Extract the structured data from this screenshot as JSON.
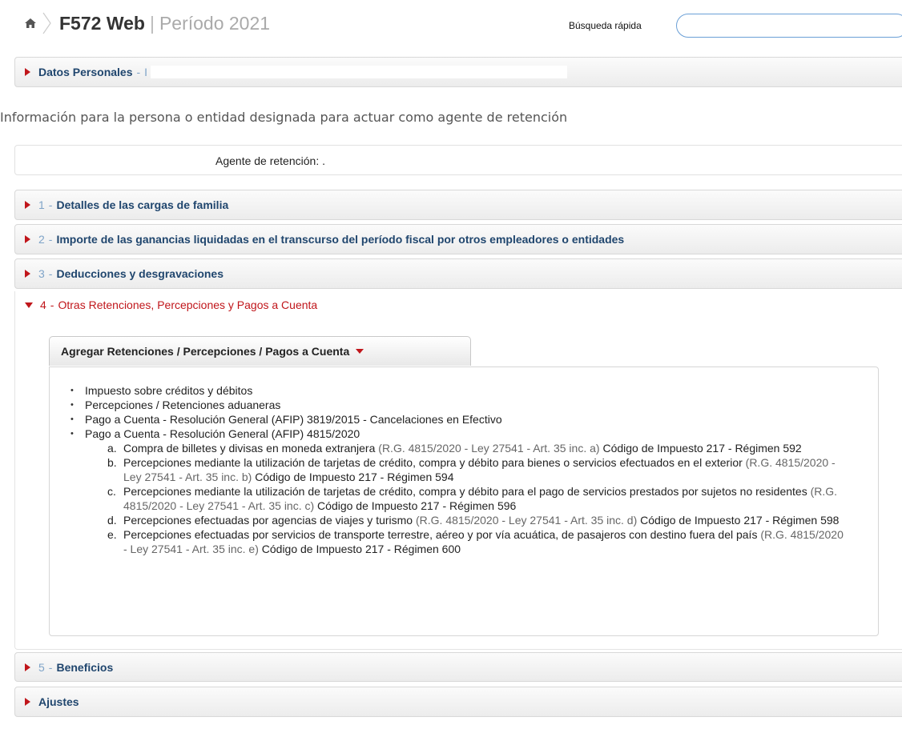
{
  "header": {
    "app_name": "F572 Web",
    "separator": "|",
    "period": "Período 2021",
    "quick_search_label": "Búsqueda rápida",
    "quick_search_value": ""
  },
  "datos_personales": {
    "label": "Datos Personales",
    "dash": "-",
    "value_prefix": "I"
  },
  "info_text": "Información para la persona o entidad designada para actuar como agente de retención",
  "agente": {
    "label": "Agente de retención: ."
  },
  "sections": [
    {
      "num": "1",
      "dash": "-",
      "title": "Detalles de las cargas de familia"
    },
    {
      "num": "2",
      "dash": "-",
      "title": "Importe de las ganancias liquidadas en el transcurso del período fiscal por otros empleadores o entidades"
    },
    {
      "num": "3",
      "dash": "-",
      "title": "Deducciones y desgravaciones"
    },
    {
      "num": "4",
      "dash": "-",
      "title": "Otras Retenciones, Percepciones y Pagos a Cuenta"
    },
    {
      "num": "5",
      "dash": "-",
      "title": "Beneficios"
    },
    {
      "num": "",
      "dash": "",
      "title": "Ajustes"
    }
  ],
  "add_button": {
    "label": "Agregar Retenciones / Percepciones / Pagos a Cuenta"
  },
  "list": {
    "items": [
      "Impuesto sobre créditos y débitos",
      "Percepciones / Retenciones aduaneras",
      "Pago a Cuenta - Resolución General (AFIP) 3819/2015 - Cancelaciones en Efectivo",
      "Pago a Cuenta - Resolución General (AFIP) 4815/2020"
    ],
    "sub_items": [
      {
        "letter": "a.",
        "main": "Compra de billetes y divisas en moneda extranjera",
        "ref": "(R.G. 4815/2020 - Ley 27541 - Art. 35 inc. a)",
        "code": "Código de Impuesto 217 - Régimen 592"
      },
      {
        "letter": "b.",
        "main": "Percepciones mediante la utilización de tarjetas de crédito, compra y débito para bienes o servicios efectuados en el exterior",
        "ref": "(R.G. 4815/2020 - Ley 27541 - Art. 35 inc. b)",
        "code": "Código de Impuesto 217 - Régimen 594"
      },
      {
        "letter": "c.",
        "main": "Percepciones mediante la utilización de tarjetas de crédito, compra y débito para el pago de servicios prestados por sujetos no residentes",
        "ref": "(R.G. 4815/2020 - Ley 27541 - Art. 35 inc. c)",
        "code": "Código de Impuesto 217 - Régimen 596"
      },
      {
        "letter": "d.",
        "main": "Percepciones efectuadas por agencias de viajes y turismo",
        "ref": "(R.G. 4815/2020 - Ley 27541 - Art. 35 inc. d)",
        "code": "Código de Impuesto 217 - Régimen 598"
      },
      {
        "letter": "e.",
        "main": "Percepciones efectuadas por servicios de transporte terrestre, aéreo y por vía acuática, de pasajeros con destino fuera del país",
        "ref": "(R.G. 4815/2020 - Ley 27541 - Art. 35 inc. e)",
        "code": "Código de Impuesto 217 - Régimen 600"
      }
    ]
  },
  "icons": {
    "home": "home-icon",
    "expand": "triangle-right-icon",
    "collapse": "triangle-down-icon",
    "dropdown": "caret-down-icon"
  },
  "colors": {
    "title_blue": "#20466e",
    "active_red": "#c0161b",
    "number_blue": "#7fa4c8"
  }
}
